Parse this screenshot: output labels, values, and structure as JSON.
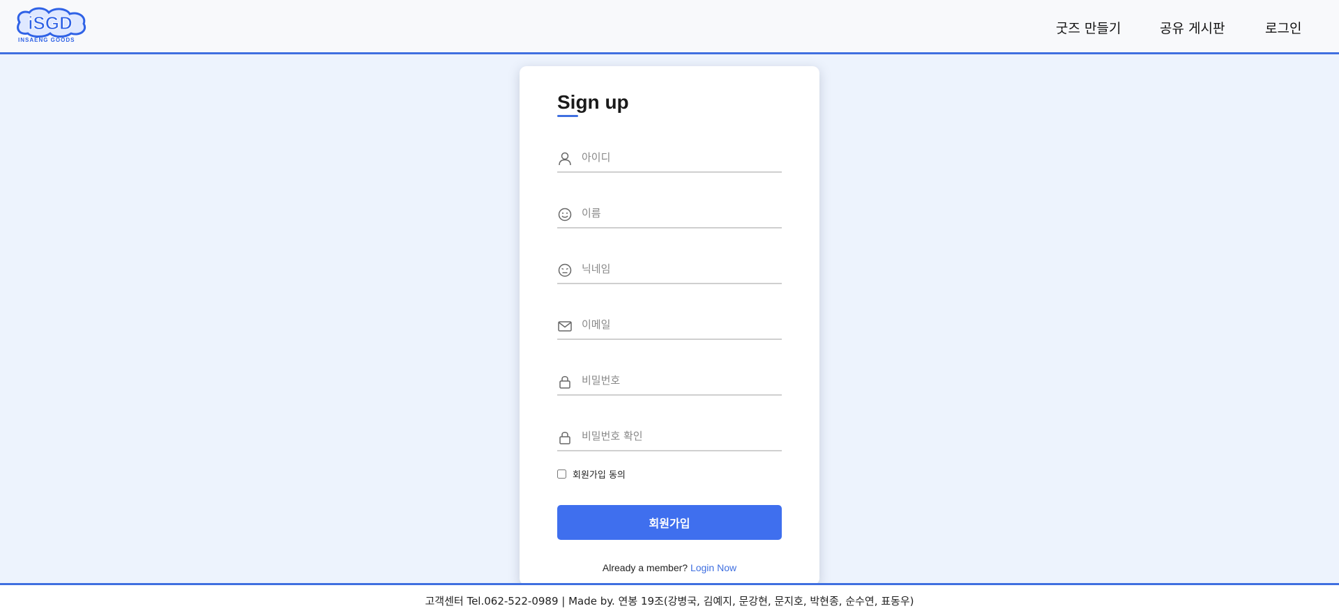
{
  "header": {
    "logo_text": "iSGD",
    "logo_subtitle": "INSAENG GOODS",
    "nav": {
      "goods": "굿즈 만들기",
      "board": "공유 게시판",
      "login": "로그인"
    }
  },
  "signup": {
    "title": "Sign up",
    "fields": {
      "id": {
        "placeholder": "아이디",
        "icon": "user-icon"
      },
      "name": {
        "placeholder": "이름",
        "icon": "smile-icon"
      },
      "nickname": {
        "placeholder": "닉네임",
        "icon": "face-icon"
      },
      "email": {
        "placeholder": "이메일",
        "icon": "mail-icon"
      },
      "password": {
        "placeholder": "비밀번호",
        "icon": "lock-icon"
      },
      "password_confirm": {
        "placeholder": "비밀번호 확인",
        "icon": "lock-icon"
      }
    },
    "agree_label": "회원가입 동의",
    "submit_label": "회원가입",
    "member_text": "Already a member?",
    "login_link": "Login Now"
  },
  "footer": {
    "text": "고객센터 Tel.062-522-0989 | Made by. 연봉 19조(강병국, 김예지, 문강현, 문지호, 박현종, 순수연, 표동우)"
  },
  "colors": {
    "accent": "#3f6fe0",
    "page_bg": "#edf3fd",
    "button": "#3f6fee"
  }
}
